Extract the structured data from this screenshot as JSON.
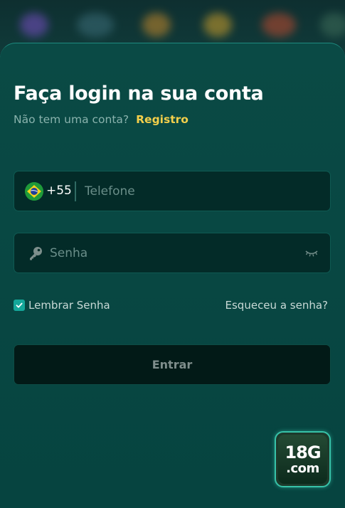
{
  "login": {
    "title": "Faça login na sua conta",
    "subtitle": "Não tem uma conta?",
    "register_link": "Registro"
  },
  "phone": {
    "country_code": "+55",
    "placeholder": "Telefone",
    "flag_icon": "brazil-flag-icon"
  },
  "password": {
    "placeholder": "Senha",
    "leading_icon": "key-icon",
    "toggle_icon": "eye-closed-icon"
  },
  "options": {
    "remember_label": "Lembrar Senha",
    "remember_checked": true,
    "forgot_link": "Esqueceu a senha?"
  },
  "submit": {
    "label": "Entrar"
  },
  "brand": {
    "logo_top": "18G",
    "logo_bottom": ".com"
  },
  "colors": {
    "accent": "#f3cf4b",
    "checkbox": "#14a79a",
    "panel": "#0a4a45"
  }
}
